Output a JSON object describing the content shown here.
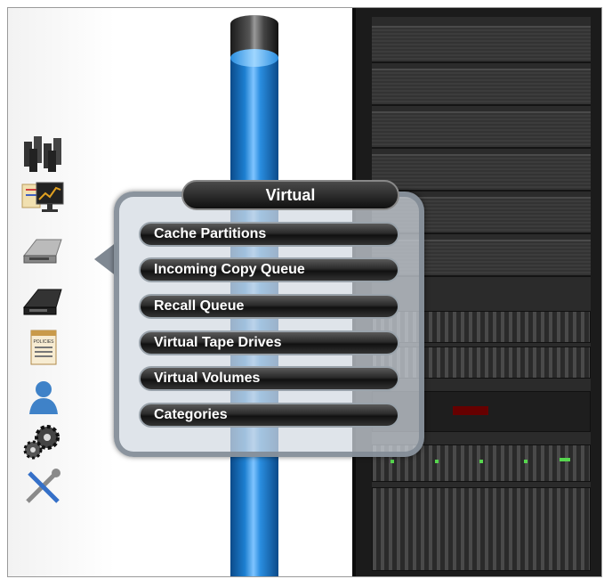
{
  "sidebar": {
    "icons": [
      {
        "name": "cluster-icon"
      },
      {
        "name": "monitor-icon"
      },
      {
        "name": "tape-drive-icon"
      },
      {
        "name": "physical-drive-icon"
      },
      {
        "name": "policies-icon"
      },
      {
        "name": "user-icon"
      },
      {
        "name": "gears-icon"
      },
      {
        "name": "tools-icon"
      }
    ],
    "policies_label": "POLICIES"
  },
  "popup": {
    "title": "Virtual",
    "items": [
      {
        "label": "Cache Partitions"
      },
      {
        "label": "Incoming Copy Queue"
      },
      {
        "label": "Recall Queue"
      },
      {
        "label": "Virtual Tape Drives"
      },
      {
        "label": "Virtual Volumes"
      },
      {
        "label": "Categories"
      }
    ]
  },
  "colors": {
    "cylinder_blue": "#1d7fd0",
    "rack_dark": "#1b1b1b",
    "led_green": "#56d64e"
  }
}
